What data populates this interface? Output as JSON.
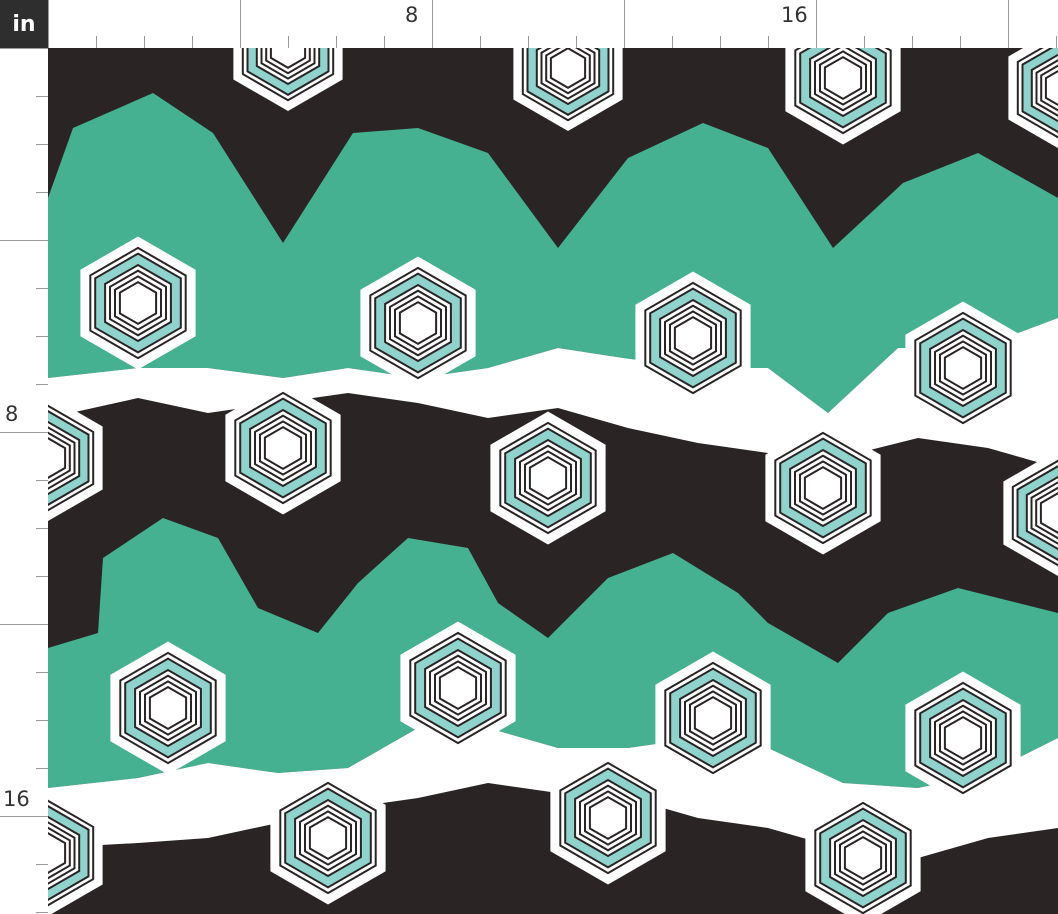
{
  "ruler": {
    "unit_label": "in",
    "top_labels": [
      "8",
      "16"
    ],
    "left_labels": [
      "8",
      "16"
    ]
  },
  "colors": {
    "teal": "#45b191",
    "dark": "#2b2425",
    "white": "#ffffff",
    "light_teal": "#8fd3cc",
    "ruler_bg": "#2e2e2e"
  }
}
